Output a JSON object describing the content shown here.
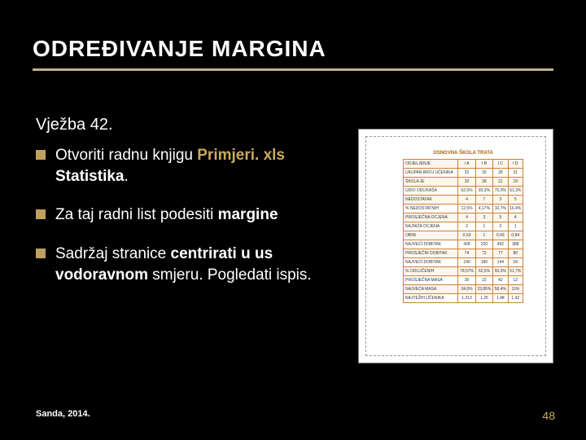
{
  "title": "ODREĐIVANJE MARGINA",
  "subtitle": "Vježba 42.",
  "bullets": [
    {
      "pre": "Otvoriti radnu knjigu ",
      "bold1": "Primjeri. xls",
      "mid": " ",
      "bold2": "Statistika",
      "post": "."
    },
    {
      "pre": "Za taj radni list podesiti ",
      "bold2": "margine",
      "post": ""
    },
    {
      "pre": "Sadržaj stranice ",
      "bold2": "centrirati u us",
      "mid2": " ",
      "bold3": "vodoravnom",
      "post": " smjeru. Pogledati  ispis."
    }
  ],
  "footer_left": "Sanda, 2014.",
  "footer_right": "48",
  "preview": {
    "table_title": "OSNOVNA ŠKOLA TRATA",
    "rows": [
      [
        "ODJELJENJE",
        "I A",
        "I B",
        "I C",
        "I D"
      ],
      [
        "UKUPAN BROJ UČENIKA",
        "32",
        "30",
        "28",
        "31"
      ],
      [
        "ŠKOLA JE",
        "20",
        "28",
        "21",
        "19"
      ],
      [
        "UDIO ODLIKAŠA",
        "62,5%",
        "93,3%",
        "75,0%",
        "61,3%"
      ],
      [
        "NEDOSTATAK",
        "4",
        "7",
        "3",
        "5"
      ],
      [
        "% NEDOSTATNIH",
        "12,5%",
        "4,17%",
        "10,7%",
        "16,4%"
      ],
      [
        "PROSJEČNA OCJENA",
        "4",
        "3",
        "5",
        "4"
      ],
      [
        "NAJNIŽA OCJENA",
        "2",
        "1",
        "2",
        "1"
      ],
      [
        "OBIM",
        "0,53",
        "1",
        "0,43",
        "0,84"
      ],
      [
        "NAJVEĆI DOBITAK",
        "428",
        "220",
        "492",
        "388"
      ],
      [
        "PROSJEČNI DOBITAK",
        "74",
        "72",
        "77",
        "80"
      ],
      [
        "NAJVEĆI DOBITAK",
        "140",
        "180",
        "144",
        "59"
      ],
      [
        "% ODLUČENIH",
        "78,57%",
        "62,5%",
        "50,0%",
        "51,7%"
      ],
      [
        "PROSJEČNA MASA",
        "30",
        "22",
        "42",
        "12"
      ],
      [
        "NAJVEĆA MASA",
        "34,6%",
        "23,85%",
        "58,4%",
        "11%"
      ],
      [
        "NAJTEŽIH UČENIKA",
        "1,313",
        "1,26",
        "1,48",
        "1,42"
      ]
    ]
  }
}
